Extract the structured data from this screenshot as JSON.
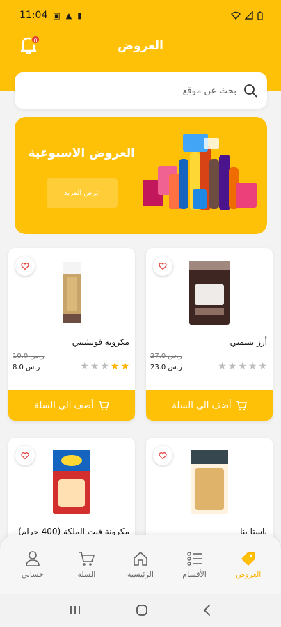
{
  "status_bar": {
    "time": "11:04"
  },
  "header": {
    "title": "العروض",
    "notification_count": "0"
  },
  "search": {
    "placeholder": "بحث عن موقع"
  },
  "banner": {
    "title": "العروض الاسبوعية",
    "button_label": "عرض المزيد"
  },
  "products": [
    {
      "name": "مكرونه فوتشيني",
      "old_price": "10.0 ر.س",
      "price": "8.0 ر.س",
      "rating": 2,
      "cart_label": "أضف الي السلة"
    },
    {
      "name": "أرز بسمتي",
      "old_price": "27.0 ر.س",
      "price": "23.0 ر.س",
      "rating": 0,
      "cart_label": "أضف الي السلة"
    },
    {
      "name": "مكرونة فيت الملكة (400 جرام)"
    },
    {
      "name": "باستا بنا"
    }
  ],
  "bottom_nav": {
    "items": [
      {
        "label": "حسابي",
        "icon": "user-icon"
      },
      {
        "label": "السلة",
        "icon": "cart-icon"
      },
      {
        "label": "الرئيسية",
        "icon": "home-icon"
      },
      {
        "label": "الأقسام",
        "icon": "list-icon"
      },
      {
        "label": "العروض",
        "icon": "tag-icon",
        "active": true
      }
    ]
  },
  "colors": {
    "accent": "#ffc107",
    "star_active": "#ffb300",
    "star_inactive": "#bdbdbd",
    "badge": "#e53935"
  }
}
